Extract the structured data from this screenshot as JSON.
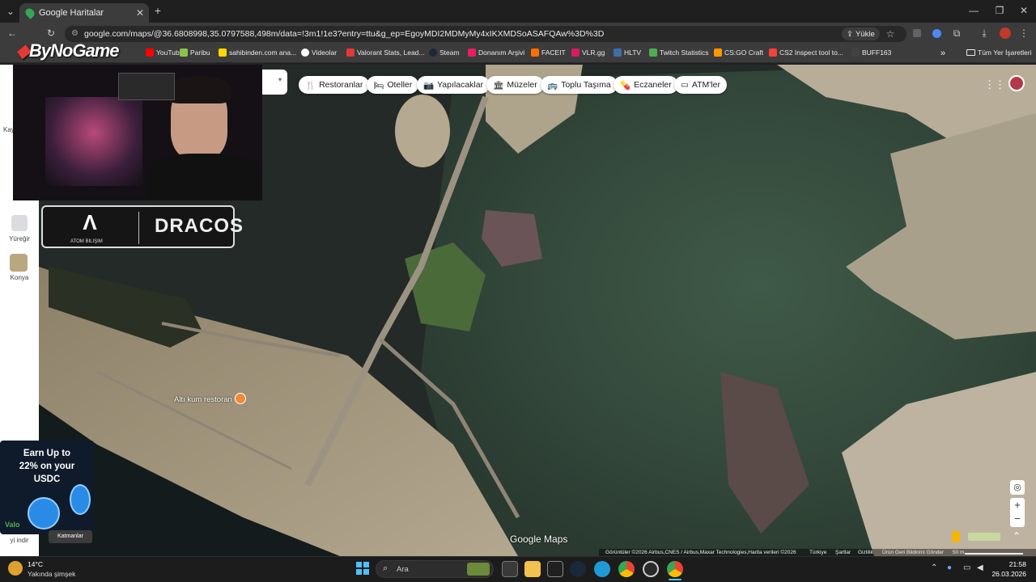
{
  "browser": {
    "tab_title": "Google Haritalar",
    "url": "google.com/maps/@36.6808998,35.0797588,498m/data=!3m1!1e3?entry=ttu&g_ep=EgoyMDI2MDMyMy4xIKXMDSoASAFQAw%3D%3D",
    "upload_label": "Yükle",
    "new_tab": "+",
    "bookmarks": [
      "YouTube",
      "Paribu",
      "sahibinden.com ana...",
      "Videolar",
      "Valorant Stats, Lead...",
      "Steam",
      "Donanım Arşivi",
      "FACEIT",
      "VLR.gg",
      "HLTV",
      "Twitch Statistics",
      "CS:GO Craft",
      "CS2 Inspect tool to...",
      "BUFF163"
    ],
    "all_bookmarks": "Tüm Yer İşaretleri",
    "overflow": "»"
  },
  "stream_overlay": {
    "logo_text": "ByNoGame",
    "sponsor_left": "ATOM BILIŞIM",
    "sponsor_right": "DRACOS",
    "ad_line1": "Earn Up to",
    "ad_line2": "22% on your",
    "ad_line3": "USDC",
    "ad_tag": "Valo"
  },
  "map": {
    "chips": [
      "Restoranlar",
      "Oteller",
      "Yapılacaklar",
      "Müzeler",
      "Toplu Taşıma",
      "Eczaneler",
      "ATM'ler"
    ],
    "place_label": "Altı kum restoran",
    "watermark": "Google Maps",
    "attribution": "Görüntüler ©2026 Airbus,CNES / Airbus,Maxar Technologies,Harita verileri ©2026",
    "footer_links": [
      "Türkiye",
      "Şartlar",
      "Gizlilik",
      "Ürün Geri Bildirimi Gönder"
    ],
    "scale": "50 m",
    "left_rail": [
      "Yüreğir",
      "Konya"
    ],
    "left_rail_partial": [
      "Kay",
      "yi indir",
      "Katmanlar"
    ]
  },
  "taskbar": {
    "weather_temp": "14°C",
    "weather_desc": "Yakında şimşek",
    "search_placeholder": "Ara",
    "time": "21:58",
    "date": "26.03.2026"
  }
}
